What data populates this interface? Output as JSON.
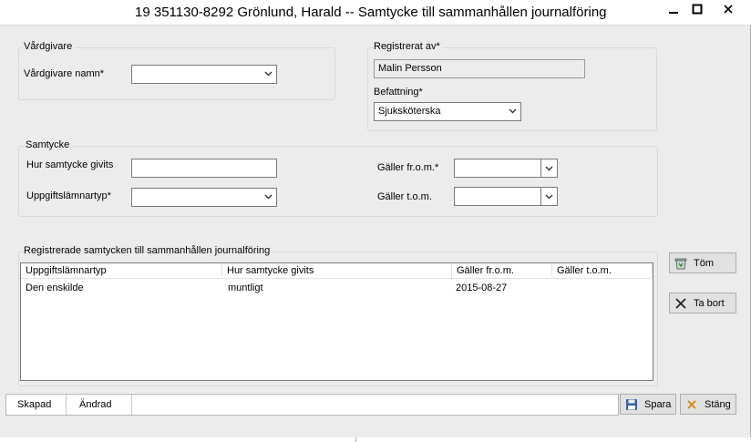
{
  "window": {
    "title": "19 351130-8292  Grönlund, Harald  -- Samtycke till sammanhållen journalföring",
    "controls": {
      "minimize": "−",
      "maximize": "□",
      "close": "✕"
    }
  },
  "vardgivare": {
    "group_label": "Vårdgivare",
    "name_label": "Vårdgivare namn*",
    "name_value": ""
  },
  "registrerat": {
    "group_label": "Registrerat av*",
    "value": "Malin Persson",
    "befattning_label": "Befattning*",
    "befattning_value": "Sjuksköterska"
  },
  "samtycke": {
    "group_label": "Samtycke",
    "hur_label": "Hur samtycke givits",
    "hur_value": "",
    "uppgift_label": "Uppgiftslämnartyp*",
    "uppgift_value": "",
    "from_label": "Gäller fr.o.m.*",
    "from_value": "",
    "tom_label": "Gäller t.o.m.",
    "tom_value": ""
  },
  "registrerade": {
    "group_label": "Registrerade samtycken till sammanhållen journalföring",
    "columns": [
      "Uppgiftslämnartyp",
      "Hur samtycke givits",
      "Gäller fr.o.m.",
      "Gäller t.o.m."
    ],
    "rows": [
      [
        "Den enskilde",
        "muntligt",
        "2015-08-27",
        ""
      ]
    ]
  },
  "side_buttons": {
    "tom": "Töm",
    "ta_bort": "Ta bort"
  },
  "statusbar": {
    "skapad": "Skapad",
    "andrad": "Ändrad"
  },
  "footer_buttons": {
    "spara": "Spara",
    "stang": "Stäng"
  },
  "colors": {
    "window_bg": "#ececec",
    "title_bg": "#ffffff",
    "close_x_accent": "#d88b1b",
    "save_icon": "#3a5fa8"
  }
}
